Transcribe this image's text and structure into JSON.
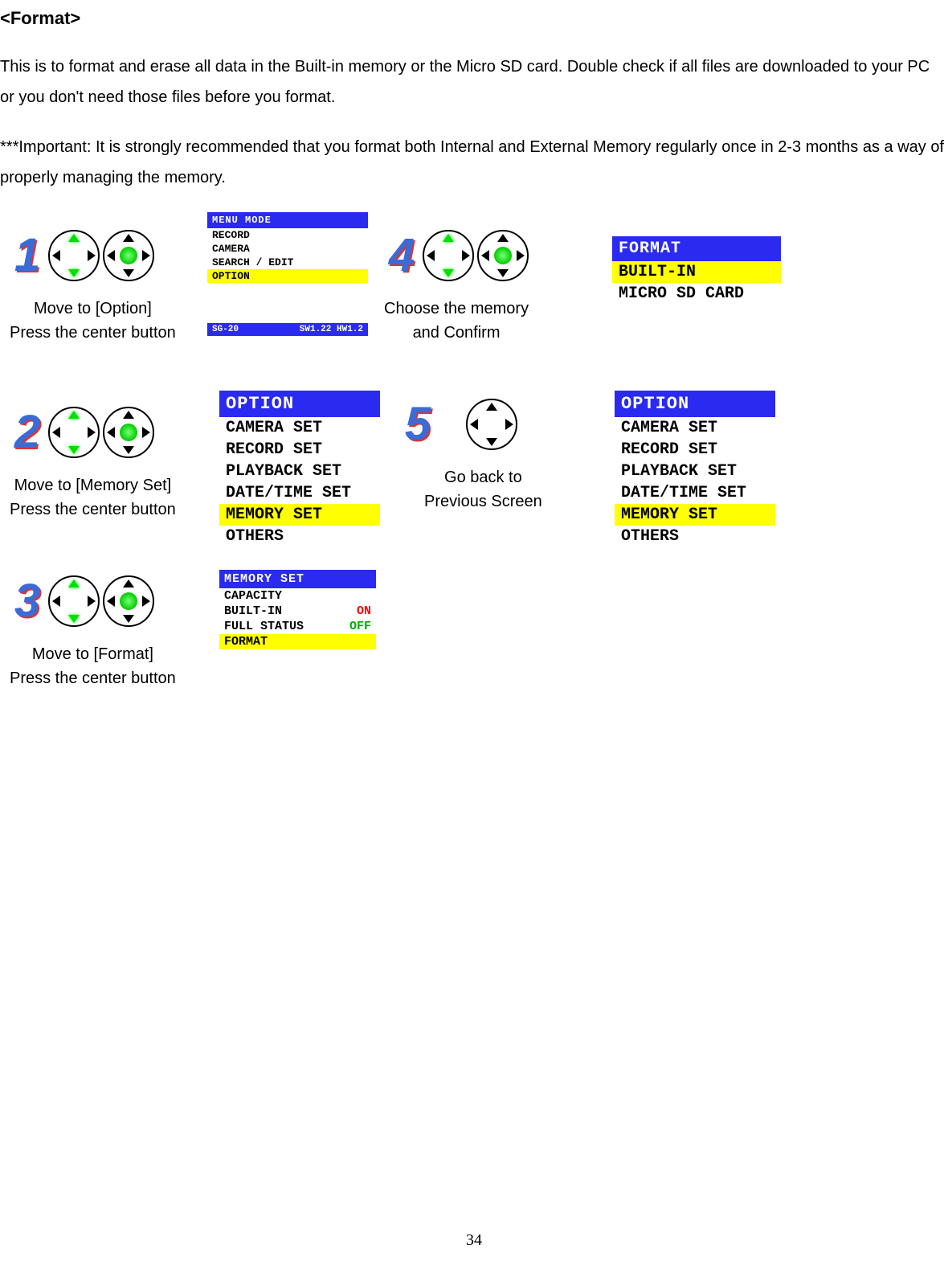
{
  "heading": "<Format>",
  "para1": "This is to format and erase all data in the Built-in memory or the Micro SD card. Double check if all files are downloaded to your PC or you don't need those files before you format.",
  "para2": "***Important: It is strongly recommended that you format both Internal and External Memory regularly once in 2-3 months as a way of properly managing the memory.",
  "steps": {
    "s1": {
      "num": "1",
      "line1": "Move to [Option]",
      "line2": "Press the center button"
    },
    "s2": {
      "num": "2",
      "line1": "Move to [Memory Set]",
      "line2": "Press the center button"
    },
    "s3": {
      "num": "3",
      "line1": "Move to [Format]",
      "line2": "Press the center button"
    },
    "s4": {
      "num": "4",
      "line1": "Choose the memory",
      "line2": "and Confirm"
    },
    "s5": {
      "num": "5",
      "line1": "Go back to",
      "line2": "Previous Screen"
    }
  },
  "screens": {
    "menu1": {
      "title": "MENU MODE",
      "rows": [
        "RECORD",
        "CAMERA",
        "SEARCH / EDIT",
        "OPTION"
      ],
      "sel": 3,
      "status_left": "SG-20",
      "status_right": "SW1.22 HW1.2"
    },
    "option": {
      "title": "OPTION",
      "rows": [
        "CAMERA SET",
        "RECORD SET",
        "PLAYBACK SET",
        "DATE/TIME SET",
        "MEMORY SET",
        "OTHERS"
      ],
      "sel": 4
    },
    "memset": {
      "title": "MEMORY SET",
      "rows": [
        {
          "label": "CAPACITY",
          "val": ""
        },
        {
          "label": "BUILT-IN",
          "val": "ON",
          "cls": "val-on"
        },
        {
          "label": "FULL STATUS",
          "val": "OFF",
          "cls": "val-off"
        },
        {
          "label": "FORMAT",
          "val": ""
        }
      ],
      "sel": 3
    },
    "format": {
      "title": "FORMAT",
      "rows": [
        "BUILT-IN",
        "MICRO SD CARD"
      ],
      "sel": 0
    }
  },
  "page_number": "34"
}
